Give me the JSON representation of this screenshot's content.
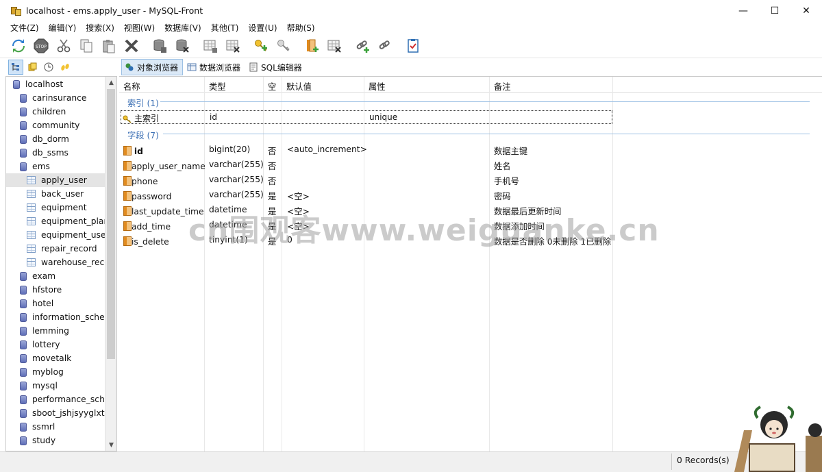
{
  "window": {
    "title": "localhost - ems.apply_user - MySQL-Front",
    "controls": {
      "minimize": "—",
      "maximize": "☐",
      "close": "✕"
    }
  },
  "menu": [
    "文件(Z)",
    "编辑(Y)",
    "搜索(X)",
    "视图(W)",
    "数据库(V)",
    "其他(T)",
    "设置(U)",
    "帮助(S)"
  ],
  "toolbar_icons": [
    "refresh-icon",
    "stop-icon",
    "cut-icon",
    "copy-icon",
    "paste-icon",
    "delete-icon",
    "database-add-icon",
    "database-delete-icon",
    "table-add-icon",
    "table-delete-icon",
    "key-add-icon",
    "key-delete-icon",
    "field-add-icon",
    "field-delete-icon",
    "link-add-icon",
    "link-delete-icon",
    "properties-icon"
  ],
  "views": {
    "object_browser": "对象浏览器",
    "data_browser": "数据浏览器",
    "sql_editor": "SQL编辑器"
  },
  "tree": {
    "host": "localhost",
    "databases": [
      "carinsurance",
      "children",
      "community",
      "db_dorm",
      "db_ssms",
      "ems"
    ],
    "ems_tables": [
      "apply_user",
      "back_user",
      "equipment",
      "equipment_plan",
      "equipment_use_r",
      "repair_record",
      "warehouse_reco"
    ],
    "more_databases": [
      "exam",
      "hfstore",
      "hotel",
      "information_schem",
      "lemming",
      "lottery",
      "movetalk",
      "myblog",
      "mysql",
      "performance_sche",
      "sboot_jshjsyyglxt",
      "ssmrl",
      "study"
    ]
  },
  "grid": {
    "columns": [
      "名称",
      "类型",
      "空",
      "默认值",
      "属性",
      "备注"
    ],
    "index_group": "索引 (1)",
    "indexes": [
      {
        "name": "主索引",
        "type": "id",
        "attr": "unique"
      }
    ],
    "field_group": "字段 (7)",
    "fields": [
      {
        "name": "id",
        "type": "bigint(20)",
        "null": "否",
        "default": "<auto_increment>",
        "comment": "数据主键"
      },
      {
        "name": "apply_user_name",
        "type": "varchar(255)",
        "null": "否",
        "default": "",
        "comment": "姓名"
      },
      {
        "name": "phone",
        "type": "varchar(255)",
        "null": "否",
        "default": "",
        "comment": "手机号"
      },
      {
        "name": "password",
        "type": "varchar(255)",
        "null": "是",
        "default": "<空>",
        "comment": "密码"
      },
      {
        "name": "last_update_time",
        "type": "datetime",
        "null": "是",
        "default": "<空>",
        "comment": "数据最后更新时间"
      },
      {
        "name": "add_time",
        "type": "datetime",
        "null": "是",
        "default": "<空>",
        "comment": "数据添加时间"
      },
      {
        "name": "is_delete",
        "type": "tinyint(1)",
        "null": "是",
        "default": "0",
        "comment": "数据是否删除 0未删除 1已删除"
      }
    ]
  },
  "status": {
    "records": "0 Records(s)"
  },
  "watermark": "cn围观客www.weiguanke.cn",
  "colors": {
    "accent": "#3b6fb4",
    "selection": "#dbe9f7",
    "tree_selection": "#e4e4e4"
  }
}
